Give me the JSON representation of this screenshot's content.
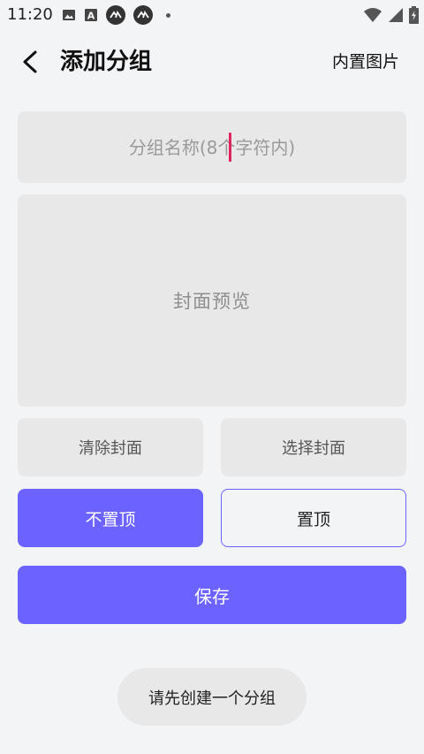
{
  "status_bar": {
    "time": "11:20",
    "left_icons": [
      "image-icon",
      "font-a-icon",
      "cast-icon",
      "cast-icon",
      "dot-icon"
    ],
    "right_icons": [
      "wifi-icon",
      "signal-icon",
      "battery-icon"
    ]
  },
  "header": {
    "title": "添加分组",
    "action_label": "内置图片"
  },
  "form": {
    "name_placeholder": "分组名称(8个字符内)",
    "name_value": "",
    "cover_preview_label": "封面预览"
  },
  "buttons": {
    "clear_cover": "清除封面",
    "choose_cover": "选择封面",
    "not_pin": "不置顶",
    "pin": "置顶",
    "save": "保存"
  },
  "toast": {
    "message": "请先创建一个分组"
  },
  "colors": {
    "accent": "#6c63ff",
    "caret": "#e0245e",
    "background": "#f3f4f6",
    "panel": "#e8e8e8"
  }
}
